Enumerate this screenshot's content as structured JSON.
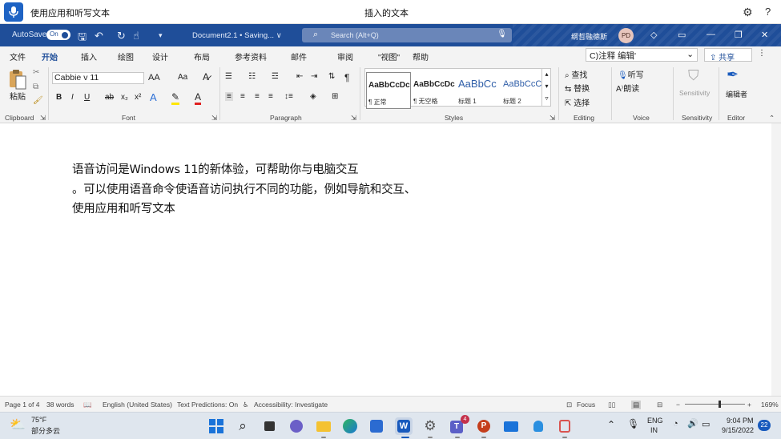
{
  "voice_access": {
    "status_text": "使用应用和听写文本",
    "center_text": "插入的文本"
  },
  "titlebar": {
    "autosave_label": "AutoSave",
    "toggle_label": "On",
    "document_title": "Document2.1 • Saving... ∨",
    "search_placeholder": "Search (Alt+Q)",
    "user_name": "纲哲融德斯",
    "avatar_initials": "PD"
  },
  "menu": {
    "tabs": [
      "文件",
      "开始",
      "插入",
      "绘图",
      "设计",
      "布局",
      "参考资料",
      "邮件",
      "审阅",
      "\"视图\"",
      "帮助"
    ],
    "comments_label": "C)注释 编辑'",
    "share_label": "共享"
  },
  "ribbon": {
    "clipboard": {
      "paste_label": "粘贴",
      "group_label": "Clipboard"
    },
    "font": {
      "font_name": "Cabbie v 11",
      "group_label": "Font",
      "grow_label": "AA",
      "case_label": "Aa",
      "bold": "B",
      "italic": "I",
      "underline": "U",
      "strike": "ab",
      "sub": "x₂",
      "sup": "x²"
    },
    "paragraph": {
      "group_label": "Paragraph",
      "pilcrow": "¶"
    },
    "styles": {
      "group_label": "Styles",
      "items": [
        {
          "preview": "AaBbCcDc",
          "name": "¶ 正常"
        },
        {
          "preview": "AaBbCcDc",
          "name": "¶ 无空格"
        },
        {
          "preview": "AaBbCc",
          "name": "标题 1"
        },
        {
          "preview": "AaBbCcC",
          "name": "标题 2"
        }
      ]
    },
    "editing": {
      "group_label": "Editing",
      "find": "查找",
      "replace": "替换",
      "select": "选择"
    },
    "voice": {
      "group_label": "Voice",
      "dictate": "听写",
      "read_aloud": "朗读"
    },
    "sensitivity": {
      "group_label": "Sensitivity",
      "button": "Sensitivity"
    },
    "editor": {
      "group_label": "Editor",
      "button": "编辑者"
    }
  },
  "document": {
    "lines": [
      "语音访问是Windows 11的新体验，可帮助你与电脑交互",
      "。可以使用语音命令使语音访问执行不同的功能，例如导航和交互、",
      "使用应用和听写文本"
    ]
  },
  "statusbar": {
    "page": "Page 1 of 4",
    "words": "38 words",
    "language": "English (United States)",
    "predictions": "Text Predictions: On",
    "accessibility": "Accessibility: Investigate",
    "focus": "Focus",
    "zoom": "169%"
  },
  "taskbar": {
    "weather_temp": "75°F",
    "weather_desc": "部分多云",
    "teams_badge": "4",
    "lang_top": "ENG",
    "lang_bottom": "IN",
    "time": "9:04 PM",
    "date": "9/15/2022",
    "notif_count": "22"
  },
  "colors": {
    "title_blue": "#1f4e99",
    "voice_blue": "#1e63c4",
    "word_blue": "#185abd"
  }
}
